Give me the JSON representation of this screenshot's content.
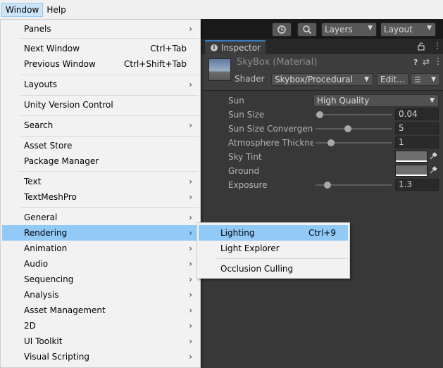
{
  "menubar": {
    "items": [
      "Window",
      "Help"
    ]
  },
  "toolbar": {
    "history_icon": "history-icon",
    "search_icon": "search-icon",
    "layers_label": "Layers",
    "layout_label": "Layout"
  },
  "inspector": {
    "tab_label": "Inspector",
    "material_name": "SkyBox (Material)",
    "shader_label": "Shader",
    "shader_value": "Skybox/Procedural",
    "edit_label": "Edit...",
    "properties": {
      "sun": {
        "label": "Sun",
        "value": "High Quality"
      },
      "sun_size": {
        "label": "Sun Size",
        "value": "0.04",
        "slider_fraction": 0.04
      },
      "sun_size_convergence": {
        "label": "Sun Size Convergenc",
        "value": "5",
        "slider_fraction": 0.5
      },
      "atmosphere_thickness": {
        "label": "Atmosphere Thicknes",
        "value": "1",
        "slider_fraction": 0.2
      },
      "sky_tint": {
        "label": "Sky Tint",
        "color": "#6e6e6e"
      },
      "ground": {
        "label": "Ground",
        "color": "#6e6e6e"
      },
      "exposure": {
        "label": "Exposure",
        "value": "1.3",
        "slider_fraction": 0.16
      }
    }
  },
  "window_menu": {
    "items": [
      {
        "label": "Panels",
        "shortcut": "",
        "submenu": true
      },
      {
        "label": "Next Window",
        "shortcut": "Ctrl+Tab",
        "submenu": false
      },
      {
        "label": "Previous Window",
        "shortcut": "Ctrl+Shift+Tab",
        "submenu": false
      },
      {
        "label": "Layouts",
        "shortcut": "",
        "submenu": true
      },
      {
        "label": "Unity Version Control",
        "shortcut": "",
        "submenu": false
      },
      {
        "label": "Search",
        "shortcut": "",
        "submenu": true
      },
      {
        "label": "Asset Store",
        "shortcut": "",
        "submenu": false
      },
      {
        "label": "Package Manager",
        "shortcut": "",
        "submenu": false
      },
      {
        "label": "Text",
        "shortcut": "",
        "submenu": true
      },
      {
        "label": "TextMeshPro",
        "shortcut": "",
        "submenu": true
      },
      {
        "label": "General",
        "shortcut": "",
        "submenu": true
      },
      {
        "label": "Rendering",
        "shortcut": "",
        "submenu": true,
        "highlighted": true
      },
      {
        "label": "Animation",
        "shortcut": "",
        "submenu": true
      },
      {
        "label": "Audio",
        "shortcut": "",
        "submenu": true
      },
      {
        "label": "Sequencing",
        "shortcut": "",
        "submenu": true
      },
      {
        "label": "Analysis",
        "shortcut": "",
        "submenu": true
      },
      {
        "label": "Asset Management",
        "shortcut": "",
        "submenu": true
      },
      {
        "label": "2D",
        "shortcut": "",
        "submenu": true
      },
      {
        "label": "UI Toolkit",
        "shortcut": "",
        "submenu": true
      },
      {
        "label": "Visual Scripting",
        "shortcut": "",
        "submenu": true
      }
    ]
  },
  "rendering_submenu": {
    "items": [
      {
        "label": "Lighting",
        "shortcut": "Ctrl+9",
        "highlighted": true
      },
      {
        "label": "Light Explorer",
        "shortcut": ""
      },
      {
        "label": "Occlusion Culling",
        "shortcut": ""
      }
    ]
  },
  "colors": {
    "menu_highlight": "#91c9f7",
    "menubar_active": "#cce4f7",
    "editor_bg": "#383838",
    "tab_accent": "#3a79bb"
  }
}
